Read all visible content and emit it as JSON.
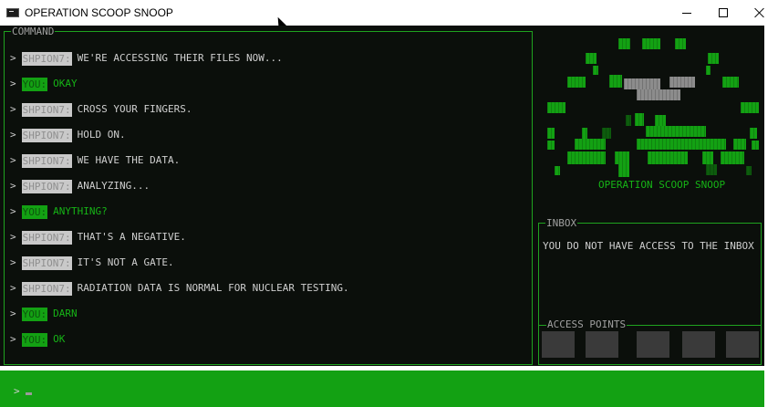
{
  "window": {
    "title": "OPERATION SCOOP SNOOP",
    "icon": "console-app-icon",
    "controls": [
      "minimize-icon",
      "maximize-icon",
      "close-icon"
    ]
  },
  "command_panel": {
    "legend": "COMMAND",
    "prompt": ">",
    "lines": [
      {
        "speaker": "SHPION7:",
        "type": "ally",
        "text": "WE'RE ACCESSING THEIR FILES NOW..."
      },
      {
        "speaker": "YOU:",
        "type": "user",
        "text": "OKAY"
      },
      {
        "speaker": "SHPION7:",
        "type": "ally",
        "text": "CROSS YOUR FINGERS."
      },
      {
        "speaker": "SHPION7:",
        "type": "ally",
        "text": "HOLD ON."
      },
      {
        "speaker": "SHPION7:",
        "type": "ally",
        "text": "WE HAVE THE DATA."
      },
      {
        "speaker": "SHPION7:",
        "type": "ally",
        "text": "ANALYZING..."
      },
      {
        "speaker": "YOU:",
        "type": "user",
        "text": "ANYTHING?"
      },
      {
        "speaker": "SHPION7:",
        "type": "ally",
        "text": "THAT'S A NEGATIVE."
      },
      {
        "speaker": "SHPION7:",
        "type": "ally",
        "text": "IT'S NOT A GATE."
      },
      {
        "speaker": "SHPION7:",
        "type": "ally",
        "text": "RADIATION DATA IS NORMAL FOR NUCLEAR TESTING."
      },
      {
        "speaker": "YOU:",
        "type": "user",
        "text": "DARN"
      },
      {
        "speaker": "YOU:",
        "type": "user",
        "text": "OK"
      }
    ]
  },
  "logo": {
    "text": "OPERATION SCOOP SNOOP"
  },
  "inbox": {
    "legend": "INBOX",
    "message": "YOU DO NOT HAVE ACCESS TO THE INBOX"
  },
  "access_points": {
    "title": "ACCESS POINTS",
    "slot_count": 5
  },
  "input": {
    "prompt": ">",
    "value": ""
  },
  "colors": {
    "terminal_bg": "#0b0f0b",
    "accent_green": "#13a113",
    "text_green": "#16b316",
    "text_gray": "#cfcfcf"
  }
}
